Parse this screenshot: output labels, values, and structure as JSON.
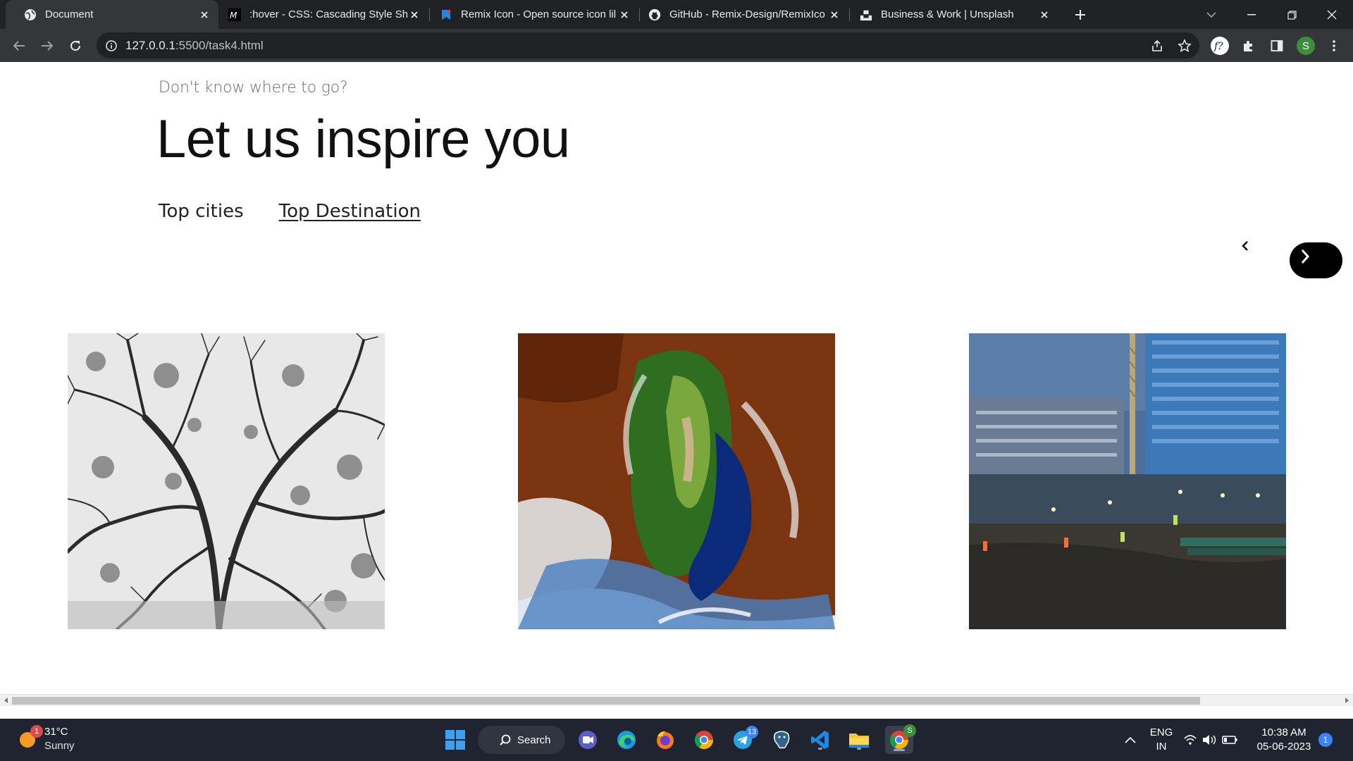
{
  "browser": {
    "tabs": [
      {
        "title": "Document",
        "icon": "globe-icon",
        "active": true
      },
      {
        "title": ":hover - CSS: Cascading Style She",
        "icon": "mdn-icon"
      },
      {
        "title": "Remix Icon - Open source icon lil",
        "icon": "remixicon-icon"
      },
      {
        "title": "GitHub - Remix-Design/RemixIco",
        "icon": "github-icon"
      },
      {
        "title": "Business & Work | Unsplash",
        "icon": "unsplash-icon"
      }
    ],
    "url_host": "127.0.0.1",
    "url_path": ":5500/task4.html",
    "profile_initial": "S"
  },
  "page": {
    "eyebrow": "Don't know where to go?",
    "headline": "Let us inspire you",
    "tabs": [
      "Top cities",
      "Top Destination"
    ],
    "selected_tab": "Top Destination",
    "cards": [
      {
        "name": "tree-branches-image",
        "desc_icon": "image"
      },
      {
        "name": "island-aerial-image",
        "desc_icon": "image"
      },
      {
        "name": "construction-site-image",
        "desc_icon": "image"
      }
    ]
  },
  "taskbar": {
    "weather_temp": "31°C",
    "weather_desc": "Sunny",
    "weather_badge": "1",
    "search_label": "Search",
    "telegram_badge": "13",
    "chrome_badge": "S",
    "lang_top": "ENG",
    "lang_bottom": "IN",
    "time": "10:38 AM",
    "date": "05-06-2023",
    "notif_count": "1"
  }
}
